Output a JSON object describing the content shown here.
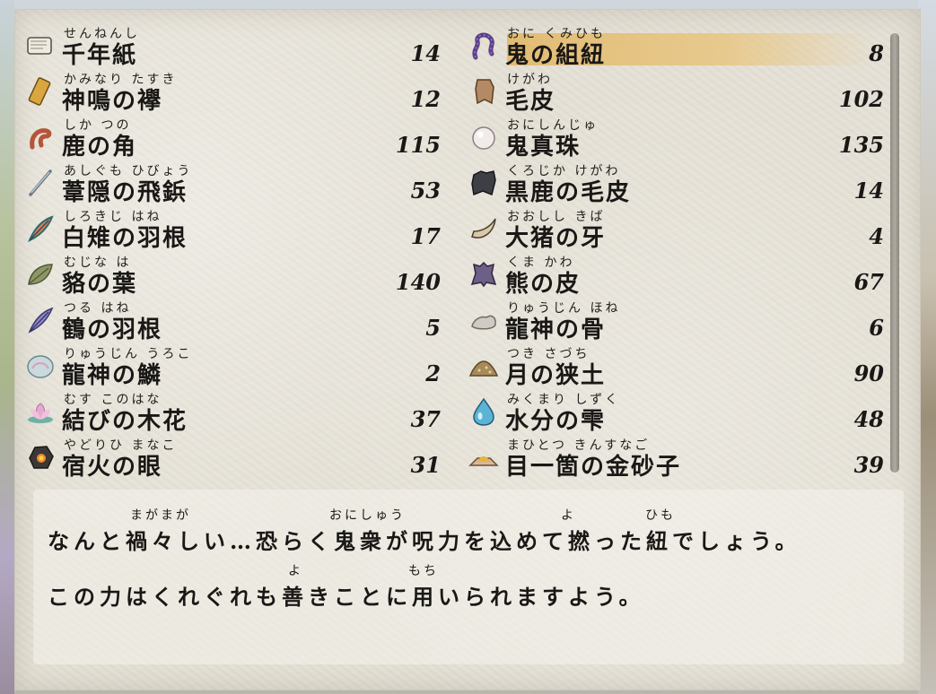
{
  "inventory": {
    "left": [
      {
        "ruby": "せんねんし",
        "name": "千年紙",
        "qty": "14",
        "icon": "scroll-paper-icon"
      },
      {
        "ruby": "かみなり たすき",
        "name": "神鳴の襷",
        "qty": "12",
        "icon": "golden-sash-icon"
      },
      {
        "ruby": "しか つの",
        "name": "鹿の角",
        "qty": "115",
        "icon": "antler-icon"
      },
      {
        "ruby": "あしぐも ひびょう",
        "name": "葦隠の飛鋲",
        "qty": "53",
        "icon": "needle-icon"
      },
      {
        "ruby": "しろきじ はね",
        "name": "白雉の羽根",
        "qty": "17",
        "icon": "pheasant-feather-icon"
      },
      {
        "ruby": "むじな は",
        "name": "貉の葉",
        "qty": "140",
        "icon": "leaf-icon"
      },
      {
        "ruby": "つる はね",
        "name": "鶴の羽根",
        "qty": "5",
        "icon": "crane-feather-icon"
      },
      {
        "ruby": "りゅうじん うろこ",
        "name": "龍神の鱗",
        "qty": "2",
        "icon": "dragon-scale-icon"
      },
      {
        "ruby": "むす このはな",
        "name": "結びの木花",
        "qty": "37",
        "icon": "lotus-flower-icon"
      },
      {
        "ruby": "やどりひ まなこ",
        "name": "宿火の眼",
        "qty": "31",
        "icon": "ember-stone-icon"
      }
    ],
    "right": [
      {
        "ruby": "おに くみひも",
        "name": "鬼の組紐",
        "qty": "8",
        "icon": "braided-cord-icon"
      },
      {
        "ruby": "けがわ",
        "name": "毛皮",
        "qty": "102",
        "icon": "fur-pelt-icon"
      },
      {
        "ruby": "おにしんじゅ",
        "name": "鬼真珠",
        "qty": "135",
        "icon": "pearl-icon"
      },
      {
        "ruby": "くろじか けがわ",
        "name": "黒鹿の毛皮",
        "qty": "14",
        "icon": "black-deer-pelt-icon"
      },
      {
        "ruby": "おおしし きば",
        "name": "大猪の牙",
        "qty": "4",
        "icon": "boar-tusk-icon"
      },
      {
        "ruby": "くま かわ",
        "name": "熊の皮",
        "qty": "67",
        "icon": "bear-hide-icon"
      },
      {
        "ruby": "りゅうじん ほね",
        "name": "龍神の骨",
        "qty": "6",
        "icon": "dragon-bone-icon"
      },
      {
        "ruby": "つき さづち",
        "name": "月の狭土",
        "qty": "90",
        "icon": "soil-pile-icon"
      },
      {
        "ruby": "みくまり しずく",
        "name": "水分の雫",
        "qty": "48",
        "icon": "water-drop-icon"
      },
      {
        "ruby": "まひとつ きんすなご",
        "name": "目一箇の金砂子",
        "qty": "39",
        "icon": "gold-sand-icon"
      }
    ],
    "selected": "鬼の組紐"
  },
  "description": {
    "line1": "なんと禍々しい…恐らく鬼衆が呪力を込めて撚った紐でしょう。",
    "line1_ruby": [
      "まがまが",
      "おにしゅう",
      "よ",
      "ひも"
    ],
    "line2": "この力はくれぐれも善きことに用いられますよう。",
    "line2_ruby": [
      "よ",
      "もち"
    ]
  },
  "colors": {
    "highlight": "#e2ba6e",
    "panel": "#e5e1d6",
    "text": "#1a1816"
  }
}
